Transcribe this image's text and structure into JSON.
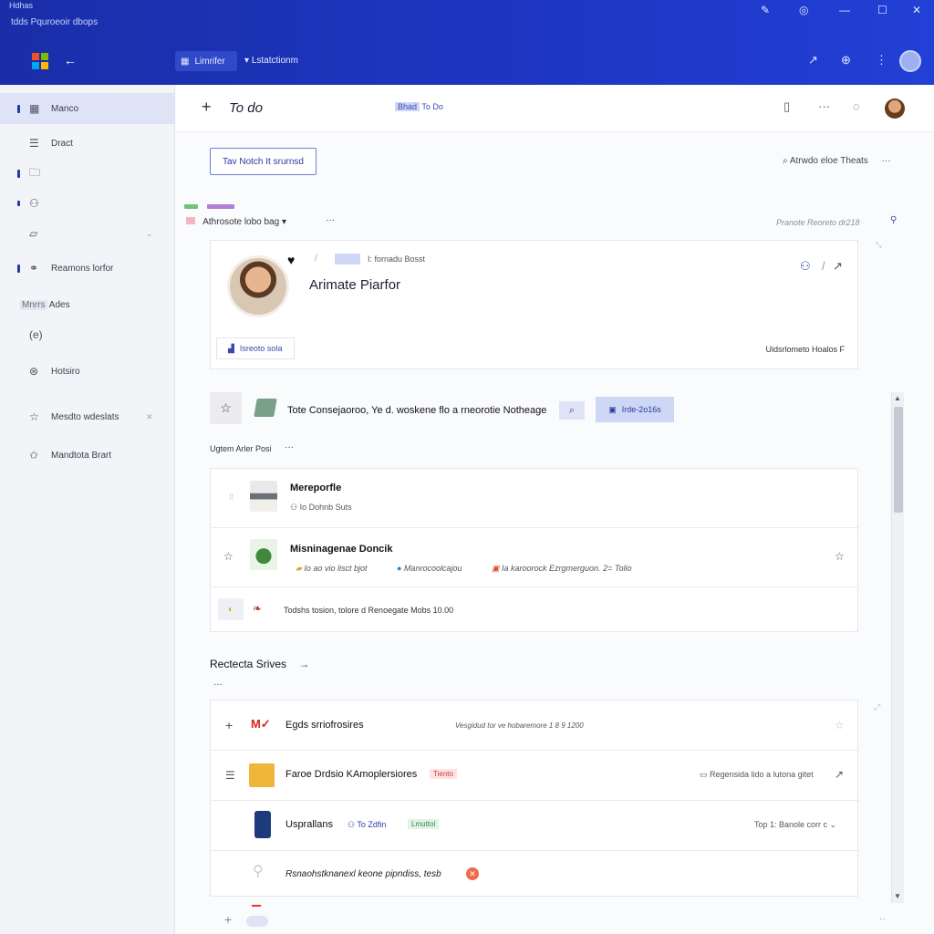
{
  "window": {
    "app_name": "Hdhas",
    "subtitle": "tdds Pquroeoir dbops"
  },
  "topbar": {
    "chip_label": "Limrifer",
    "crumb": "Lstatctionm"
  },
  "sidebar": {
    "items": [
      {
        "label": "Manco",
        "icon": "grid-icon"
      },
      {
        "label": "Dract",
        "icon": "menu-icon"
      },
      {
        "label": "",
        "icon": "folder-icon"
      },
      {
        "label": "",
        "icon": "person-icon"
      },
      {
        "label": "",
        "icon": "note-icon"
      },
      {
        "label": "Reamons lorfor",
        "icon": "people-icon"
      },
      {
        "label": "Ades",
        "icon": "section-icon"
      },
      {
        "label": "",
        "icon": "mention-icon"
      },
      {
        "label": "Hotsiro",
        "icon": "globe-icon"
      },
      {
        "label": "Mesdto wdeslats",
        "icon": "star-icon"
      },
      {
        "label": "Mandtota Brart",
        "icon": "sparkle-star-icon"
      }
    ],
    "section_prefix": "Mnrrs"
  },
  "header": {
    "title": "To do",
    "tag_highlight": "Bhad",
    "tag_text": "To Do"
  },
  "toolbar": {
    "primary_button": "Tav Notch It srurnsd",
    "right_link": "Atrwdo eloe Theats"
  },
  "feed": {
    "section_label": "Athrosote lobo bag",
    "timestamp": "Pranote Reoreto dr218"
  },
  "profile_card": {
    "meta": "I: fornadu Bosst",
    "name": "Arimate Piarfor",
    "footer_button": "Isreoto sola",
    "footer_right": "Uidsrlometo Hoalos F"
  },
  "featured": {
    "text": "Tote Consejaoroo, Ye d. woskene flo a rneorotie Notheage",
    "button": "Irde-2o16s"
  },
  "post_list": {
    "header": "Ugtem Arler Posi",
    "rows": [
      {
        "title": "Mereporfle",
        "sub": "Io Dohnb Suts"
      },
      {
        "title": "Misninagenae Doncik",
        "sub1": "Io ao vio lisct bjot",
        "sub2": "Manrocoolcajou",
        "sub3": "Ia karoorock Ezrgmerguon. 2= Tolio"
      },
      {
        "title": "",
        "text": "Todshs tosion, tolore d Renoegate Mobs 10.00"
      }
    ]
  },
  "recent": {
    "title": "Rectecta Srives",
    "rows": [
      {
        "title": "Egds srriofrosires",
        "meta": "Vesgidud tor ve hobaremore 1 8 9 1200"
      },
      {
        "title": "Faroe Drdsio KAmoplersiores",
        "badge": "Tiento",
        "right": "Regensida lido a lutona gitet"
      },
      {
        "title": "Usprallans",
        "chip": "To Zdfin",
        "badge": "Lmuttol",
        "right": "Top 1: Banole corr c"
      },
      {
        "title": "Rsnaohstknanexl keone pipndiss, tesb",
        "sub": ""
      }
    ]
  },
  "colors": {
    "titlebar": "#1e36c4",
    "accent": "#2838a8",
    "danger": "#d23a3a"
  }
}
